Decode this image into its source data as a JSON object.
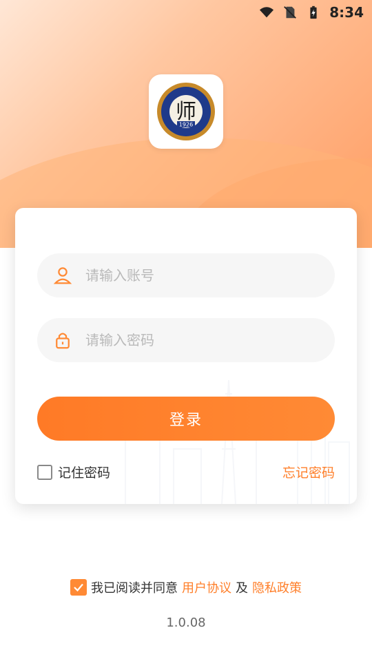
{
  "status_bar": {
    "time": "8:34"
  },
  "logo": {
    "year": "1926",
    "description": "school-seal"
  },
  "login": {
    "account_placeholder": "请输入账号",
    "password_placeholder": "请输入密码",
    "login_label": "登录",
    "remember_label": "记住密码",
    "forgot_label": "忘记密码"
  },
  "agreement": {
    "prefix": "我已阅读并同意",
    "user_agreement": "用户协议",
    "and": "及",
    "privacy_policy": "隐私政策"
  },
  "version": "1.0.08",
  "colors": {
    "accent": "#ff7f2a",
    "button": "#ff8a35"
  }
}
